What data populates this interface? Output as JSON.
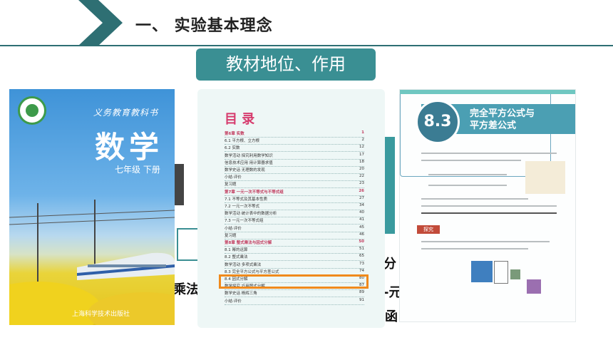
{
  "header": {
    "title": "一、  实验基本理念"
  },
  "tag": {
    "label": "教材地位、作用"
  },
  "fragments": {
    "left": "乘法",
    "right1": "分",
    "right2": "-元",
    "right3": "函"
  },
  "cover": {
    "series": "义务教育教科书",
    "subject": "数学",
    "grade": "七年级  下册",
    "publisher": "上海科学技术出版社"
  },
  "toc": {
    "title": "目  录",
    "rows": [
      {
        "label": "第6章   实数",
        "page": "1",
        "chapter": true
      },
      {
        "label": "6.1   平方根、立方根",
        "page": "2"
      },
      {
        "label": "6.2   实数",
        "page": "12"
      },
      {
        "label": "数学活动   探究利用数学知识",
        "page": "17"
      },
      {
        "label": "信息技术应用   用计算器求值",
        "page": "18"
      },
      {
        "label": "数学史话   无理数的发现",
        "page": "20"
      },
      {
        "label": "小结·评价",
        "page": "22"
      },
      {
        "label": "复习题",
        "page": "23"
      },
      {
        "label": "第7章   一元一次不等式与不等式组",
        "page": "26",
        "chapter": true
      },
      {
        "label": "7.1   不等式及其基本性质",
        "page": "27"
      },
      {
        "label": "7.2   一元一次不等式",
        "page": "34"
      },
      {
        "label": "数学活动   统计表中的数据分析",
        "page": "40"
      },
      {
        "label": "7.3   一元一次不等式组",
        "page": "41"
      },
      {
        "label": "小结·评价",
        "page": "45"
      },
      {
        "label": "复习题",
        "page": "46"
      },
      {
        "label": "第8章   整式乘法与因式分解",
        "page": "50",
        "chapter": true
      },
      {
        "label": "8.1   幂的运算",
        "page": "51"
      },
      {
        "label": "8.2   整式乘法",
        "page": "65"
      },
      {
        "label": "数学活动   多项式乘法",
        "page": "73"
      },
      {
        "label": "8.3   完全平方公式与平方差公式",
        "page": "74"
      },
      {
        "label": "8.4   因式分解",
        "page": "80"
      },
      {
        "label": "数学探究   巧用图式分解",
        "page": "87"
      },
      {
        "label": "数学史话   杨辉三角",
        "page": "89"
      },
      {
        "label": "小结·评价",
        "page": "91"
      }
    ]
  },
  "chapter_page": {
    "number": "8.3",
    "title_line1": "完全平方公式与",
    "title_line2": "平方差公式",
    "example_tag": "探究"
  }
}
